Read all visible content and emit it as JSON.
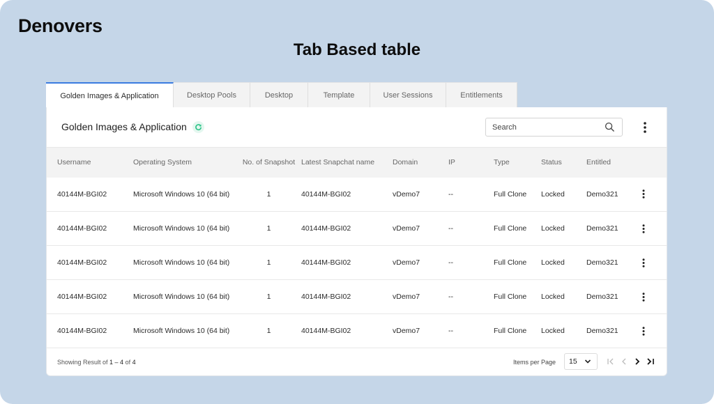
{
  "brand": "Denovers",
  "page_title": "Tab Based table",
  "tabs": [
    {
      "label": "Golden Images & Application",
      "active": true
    },
    {
      "label": "Desktop Pools",
      "active": false
    },
    {
      "label": "Desktop",
      "active": false
    },
    {
      "label": "Template",
      "active": false
    },
    {
      "label": "User Sessions",
      "active": false
    },
    {
      "label": "Entitlements",
      "active": false
    }
  ],
  "card": {
    "title": "Golden Images & Application",
    "refresh_icon": "refresh-icon",
    "search": {
      "placeholder": "Search",
      "value": "",
      "icon": "search-icon"
    },
    "menu_icon": "kebab-vertical-icon"
  },
  "table": {
    "columns": [
      "Username",
      "Operating System",
      "No. of Snapshot",
      "Latest Snapchat name",
      "Domain",
      "IP",
      "Type",
      "Status",
      "Entitled"
    ],
    "rows": [
      {
        "username": "40144M-BGI02",
        "os": "Microsoft Windows 10 (64 bit)",
        "snapshots": "1",
        "latest_snapshot": "40144M-BGI02",
        "domain": "vDemo7",
        "ip": "--",
        "type": "Full Clone",
        "status": "Locked",
        "entitled": "Demo321"
      },
      {
        "username": "40144M-BGI02",
        "os": "Microsoft Windows 10 (64 bit)",
        "snapshots": "1",
        "latest_snapshot": "40144M-BGI02",
        "domain": "vDemo7",
        "ip": "--",
        "type": "Full Clone",
        "status": "Locked",
        "entitled": "Demo321"
      },
      {
        "username": "40144M-BGI02",
        "os": "Microsoft Windows 10 (64 bit)",
        "snapshots": "1",
        "latest_snapshot": "40144M-BGI02",
        "domain": "vDemo7",
        "ip": "--",
        "type": "Full Clone",
        "status": "Locked",
        "entitled": "Demo321"
      },
      {
        "username": "40144M-BGI02",
        "os": "Microsoft Windows 10 (64 bit)",
        "snapshots": "1",
        "latest_snapshot": "40144M-BGI02",
        "domain": "vDemo7",
        "ip": "--",
        "type": "Full Clone",
        "status": "Locked",
        "entitled": "Demo321"
      },
      {
        "username": "40144M-BGI02",
        "os": "Microsoft Windows 10 (64 bit)",
        "snapshots": "1",
        "latest_snapshot": "40144M-BGI02",
        "domain": "vDemo7",
        "ip": "--",
        "type": "Full Clone",
        "status": "Locked",
        "entitled": "Demo321"
      }
    ]
  },
  "footer": {
    "showing_prefix": "Showing Result of ",
    "range": "1 – 4",
    "of_label": " of ",
    "total": "4",
    "items_per_page_label": "Items per Page",
    "items_per_page_value": "15",
    "pager_icons": [
      "first-page-icon",
      "prev-page-icon",
      "next-page-icon",
      "last-page-icon"
    ]
  },
  "colors": {
    "background": "#c5d6e8",
    "active_tab_accent": "#3a7be0",
    "refresh_accent": "#2fc48a",
    "header_row_bg": "#f3f3f3"
  }
}
